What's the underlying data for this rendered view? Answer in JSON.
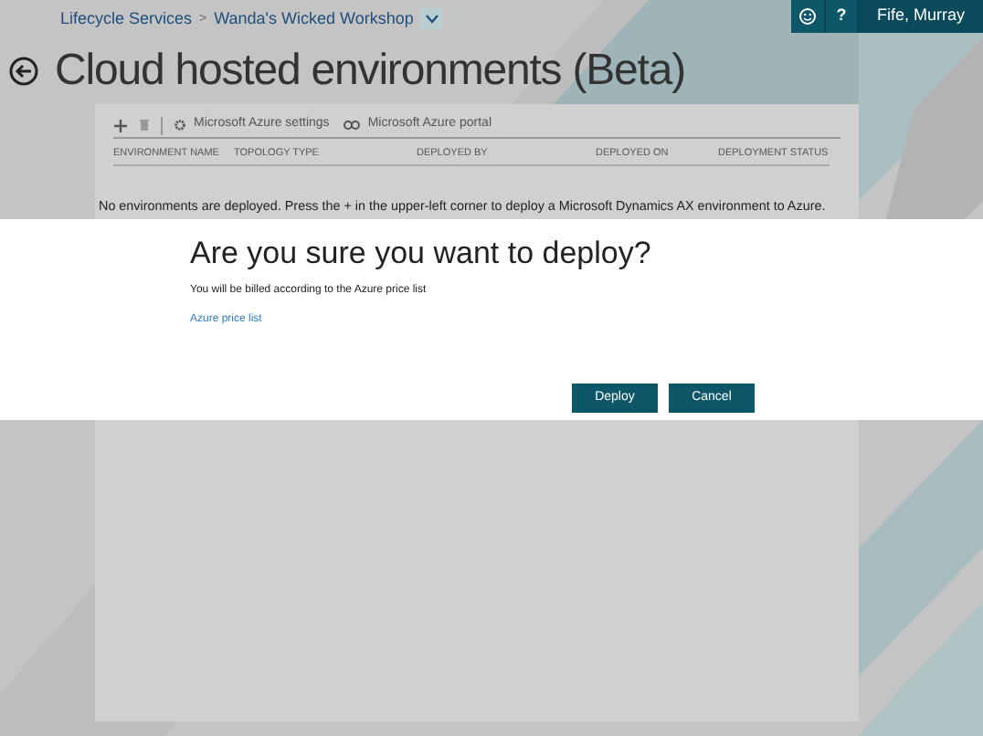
{
  "breadcrumb": {
    "items": [
      "Lifecycle Services",
      "Wanda's Wicked Workshop"
    ],
    "separator": ">"
  },
  "user": {
    "name": "Fife, Murray",
    "help": "?"
  },
  "page": {
    "title": "Cloud hosted environments (Beta)"
  },
  "toolbar": {
    "items": [
      "Microsoft Azure settings",
      "Microsoft Azure portal"
    ]
  },
  "table": {
    "columns": [
      "ENVIRONMENT NAME",
      "TOPOLOGY TYPE",
      "DEPLOYED BY",
      "DEPLOYED ON",
      "DEPLOYMENT STATUS"
    ],
    "empty_message": "No environments are deployed. Press the + in the upper-left corner to deploy a Microsoft Dynamics AX environment to Azure."
  },
  "dialog": {
    "title": "Are you sure you want to deploy?",
    "message": "You will be billed according to the Azure price list",
    "link": "Azure price list",
    "buttons": [
      "Deploy",
      "Cancel"
    ]
  }
}
